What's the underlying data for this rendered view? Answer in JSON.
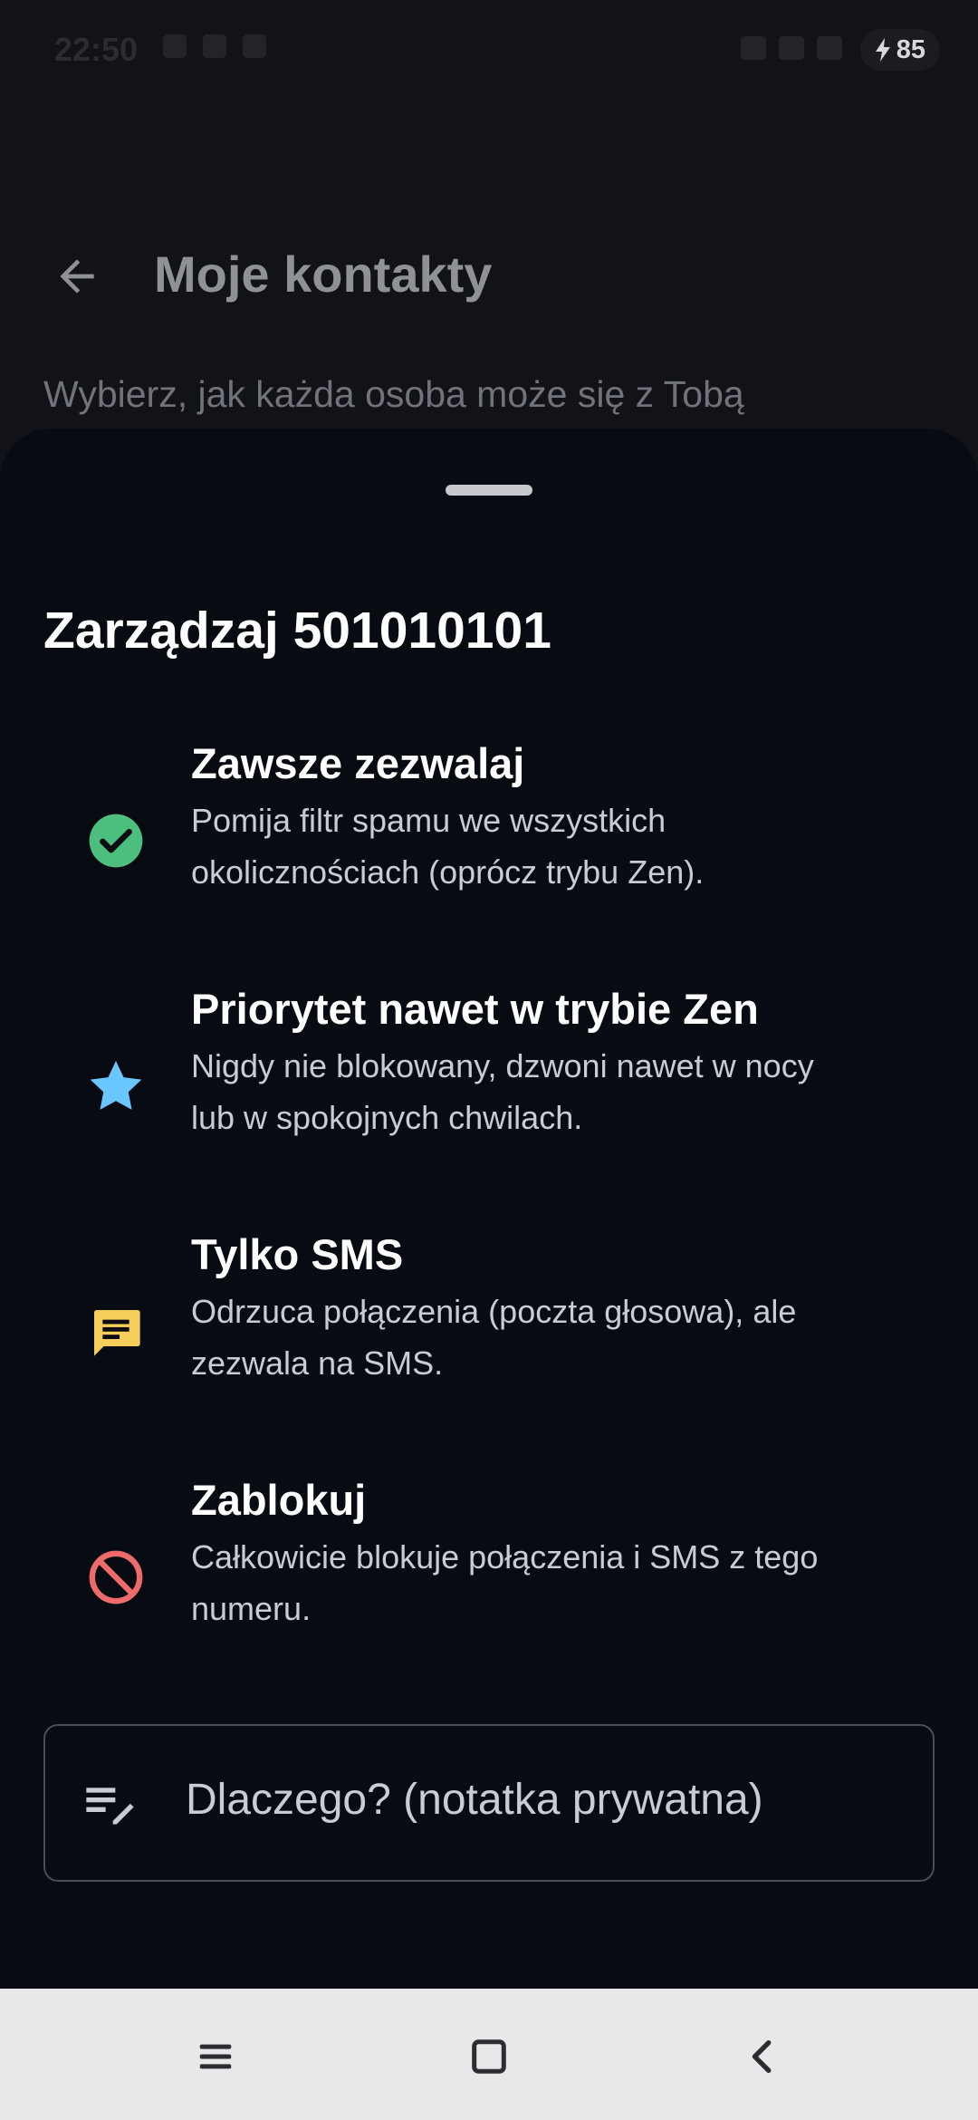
{
  "status_bar": {
    "time": "22:50",
    "battery": "85"
  },
  "header": {
    "title": "Moje kontakty",
    "subtitle": "Wybierz, jak każda osoba może się z Tobą"
  },
  "sheet": {
    "title": "Zarządzaj 501010101",
    "options": [
      {
        "title": "Zawsze zezwalaj",
        "desc_line1": "Pomija filtr spamu we wszystkich",
        "desc_line2": "okolicznościach (oprócz trybu Zen).",
        "icon": "check-circle-icon",
        "color": "#4cbf7f"
      },
      {
        "title": "Priorytet nawet w trybie Zen",
        "desc_line1": "Nigdy nie blokowany, dzwoni nawet w nocy",
        "desc_line2": "lub w spokojnych chwilach.",
        "icon": "star-icon",
        "color": "#6ac6ff"
      },
      {
        "title": "Tylko SMS",
        "desc_line1": "Odrzuca połączenia (poczta głosowa), ale",
        "desc_line2": "zezwala na SMS.",
        "icon": "message-icon",
        "color": "#f5ce5a"
      },
      {
        "title": "Zablokuj",
        "desc_line1": "Całkowicie blokuje połączenia i SMS z tego",
        "desc_line2": "numeru.",
        "icon": "block-icon",
        "color": "#ee6b6b"
      }
    ],
    "note_placeholder": "Dlaczego? (notatka prywatna)"
  }
}
